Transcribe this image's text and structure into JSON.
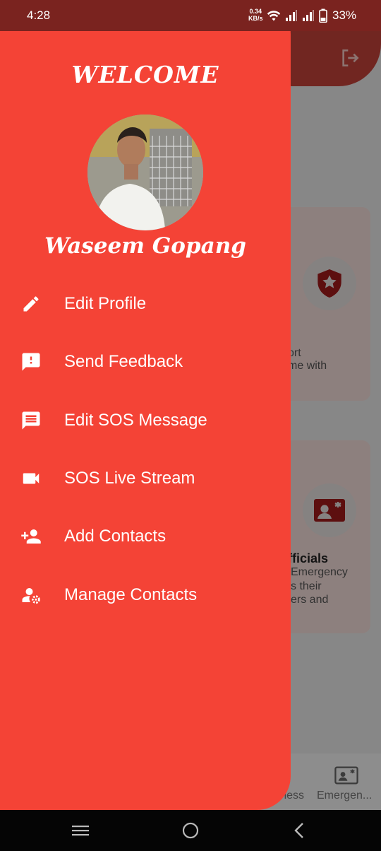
{
  "status_bar": {
    "time": "4:28",
    "net_speed_value": "0.34",
    "net_speed_unit": "KB/s",
    "battery": "33%",
    "icons": [
      "wifi-icon",
      "signal-icon",
      "signal-icon",
      "battery-icon"
    ]
  },
  "drawer": {
    "welcome": "WELCOME",
    "user_name": "Waseem Gopang",
    "items": [
      {
        "label": "Edit Profile",
        "icon": "pencil-icon"
      },
      {
        "label": "Send Feedback",
        "icon": "feedback-icon"
      },
      {
        "label": "Edit SOS Message",
        "icon": "message-icon"
      },
      {
        "label": "SOS Live Stream",
        "icon": "videocam-icon"
      },
      {
        "label": "Add Contacts",
        "icon": "person-add-icon"
      },
      {
        "label": "Manage Contacts",
        "icon": "manage-accounts-icon"
      }
    ]
  },
  "background": {
    "card1": {
      "line1": "ort",
      "line2": "me with"
    },
    "card2": {
      "title": "fficials",
      "line1": "Emergency",
      "line2": "s their",
      "line3": "ers and"
    },
    "bottom_nav": {
      "tab1": "reness",
      "tab2": "Emergen..."
    }
  },
  "colors": {
    "drawer": "#f44336",
    "status_bar": "#7a231f",
    "app_bar": "#c3423a"
  }
}
